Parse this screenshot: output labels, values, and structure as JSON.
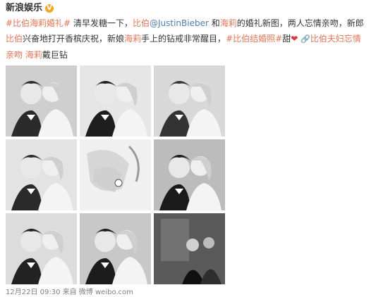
{
  "post": {
    "author": "新浪娱乐",
    "verified_badge": "V",
    "text_lines": [
      [
        {
          "t": "#比伯海莉婚礼#",
          "k": "link"
        },
        {
          "t": " 清早发糖一下，",
          "k": "plain"
        },
        {
          "t": "比伯",
          "k": "link"
        },
        {
          "t": "@JustinBieber",
          "k": "mention"
        },
        {
          "t": " 和",
          "k": "plain"
        },
        {
          "t": "海莉",
          "k": "link"
        },
        {
          "t": "的婚礼新图，两人忘情亲吻，新郎",
          "k": "plain"
        }
      ],
      [
        {
          "t": "比伯",
          "k": "link"
        },
        {
          "t": "兴奋地打开香槟庆祝，新娘",
          "k": "plain"
        },
        {
          "t": "海莉",
          "k": "link"
        },
        {
          "t": "手上的钻戒非常醒目，",
          "k": "plain"
        },
        {
          "t": "#比伯结婚照#",
          "k": "link"
        },
        {
          "t": "甜",
          "k": "plain"
        },
        {
          "t": "❤",
          "k": "heart"
        },
        {
          "t": " ",
          "k": "plain"
        },
        {
          "t": "🔗",
          "k": "attach"
        },
        {
          "t": "比伯夫妇忘情",
          "k": "link"
        }
      ],
      [
        {
          "t": "亲吻",
          "k": "link"
        },
        {
          "t": " ",
          "k": "plain"
        },
        {
          "t": "海莉",
          "k": "link"
        },
        {
          "t": "戴巨钻",
          "k": "plain"
        }
      ]
    ],
    "footer": "12月22日 09:30  来自 微博 weibo.com",
    "photos": [
      {
        "name": "photo-couple-kiss-1",
        "bg": "#cfcfcf",
        "tone": "#2b2b2b"
      },
      {
        "name": "photo-couple-kiss-2",
        "bg": "#e6e6e6",
        "tone": "#1e1e1e"
      },
      {
        "name": "photo-couple-portrait",
        "bg": "#d8d8d8",
        "tone": "#333333"
      },
      {
        "name": "photo-couple-pose",
        "bg": "#e3e3e3",
        "tone": "#2a2a2a"
      },
      {
        "name": "photo-ring-closeup",
        "bg": "#f0f0f0",
        "tone": "#555555"
      },
      {
        "name": "photo-groom-champagne",
        "bg": "#bcbcbc",
        "tone": "#1a1a1a"
      },
      {
        "name": "photo-groom-friend",
        "bg": "#dcdcdc",
        "tone": "#222222"
      },
      {
        "name": "photo-group-friends",
        "bg": "#c8c8c8",
        "tone": "#1c1c1c"
      },
      {
        "name": "photo-party-dark",
        "bg": "#5a5a5a",
        "tone": "#101010"
      }
    ]
  }
}
